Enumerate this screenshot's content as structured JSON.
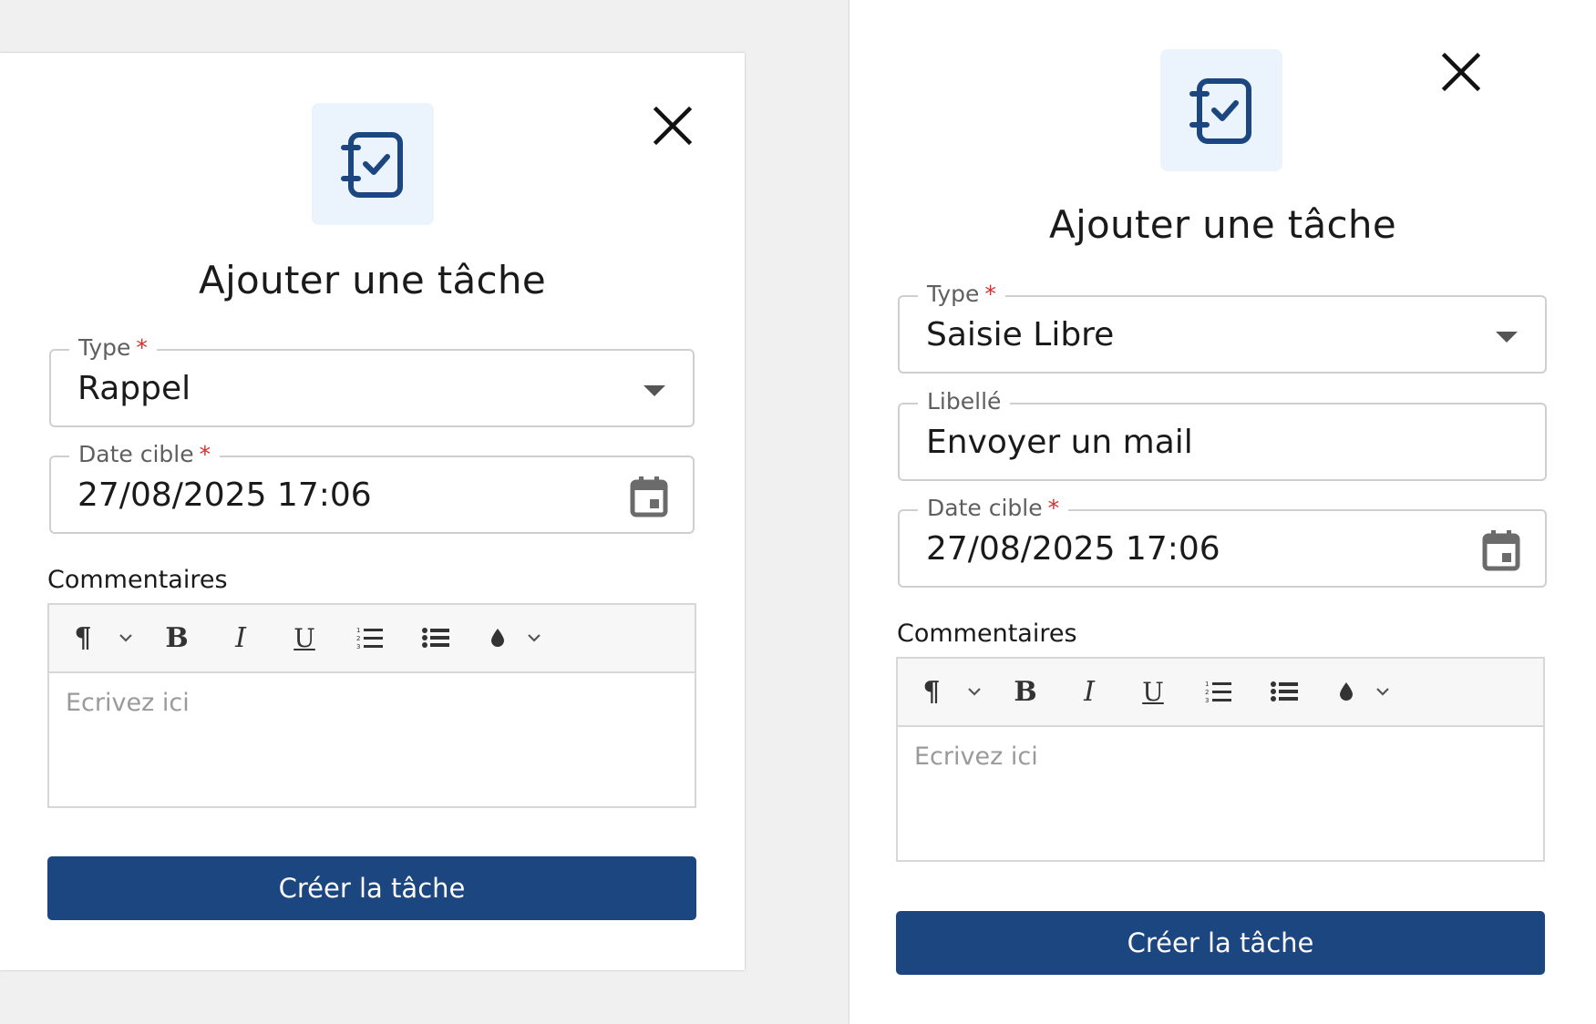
{
  "colors": {
    "accent": "#1c467f",
    "icon_tile_bg": "#ebf3fd",
    "required": "#d32f2f"
  },
  "dialogs": [
    {
      "title": "Ajouter une tâche",
      "icon": "task-notebook-check-icon",
      "type_field": {
        "label": "Type",
        "required_mark": "*",
        "value": "Rappel"
      },
      "date_field": {
        "label": "Date cible",
        "required_mark": "*",
        "value": "27/08/2025 17:06"
      },
      "comments": {
        "label": "Commentaires",
        "placeholder": "Ecrivez ici"
      },
      "submit_label": "Créer la tâche"
    },
    {
      "title": "Ajouter une tâche",
      "icon": "task-notebook-check-icon",
      "type_field": {
        "label": "Type",
        "required_mark": "*",
        "value": "Saisie Libre"
      },
      "libelle_field": {
        "label": "Libellé",
        "value": "Envoyer un mail"
      },
      "date_field": {
        "label": "Date cible",
        "required_mark": "*",
        "value": "27/08/2025 17:06"
      },
      "comments": {
        "label": "Commentaires",
        "placeholder": "Ecrivez ici"
      },
      "submit_label": "Créer la tâche"
    }
  ],
  "toolbar": {
    "paragraph_glyph": "¶",
    "bold_glyph": "B",
    "italic_glyph": "I",
    "underline_glyph": "U"
  }
}
